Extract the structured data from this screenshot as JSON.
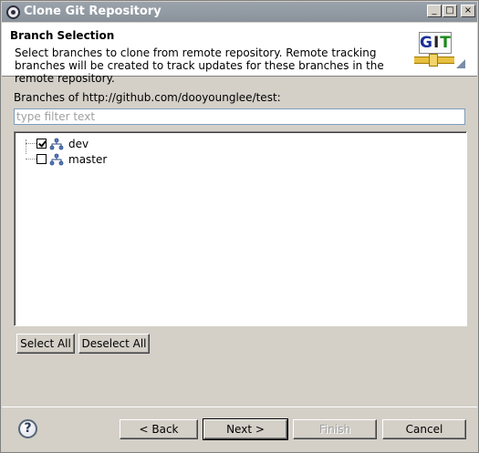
{
  "window": {
    "title": "Clone Git Repository",
    "controls": {
      "minimize": "_",
      "maximize": "□",
      "close": "×"
    }
  },
  "header": {
    "title": "Branch Selection",
    "description": "Select branches to clone from remote repository. Remote tracking branches will be created to track updates for these branches in the remote repository.",
    "logo": {
      "letters": [
        "G",
        "I",
        "T"
      ],
      "icon": "git-logo-icon"
    }
  },
  "main": {
    "branches_label": "Branches of http://github.com/dooyounglee/test:",
    "filter": {
      "value": "",
      "placeholder": "type filter text"
    },
    "branches": [
      {
        "name": "dev",
        "checked": true,
        "icon": "branch-icon"
      },
      {
        "name": "master",
        "checked": false,
        "icon": "branch-icon"
      }
    ],
    "select_all": "Select All",
    "deselect_all": "Deselect All"
  },
  "footer": {
    "help": "?",
    "back": "< Back",
    "next": "Next >",
    "finish": "Finish",
    "cancel": "Cancel",
    "finish_enabled": false
  }
}
